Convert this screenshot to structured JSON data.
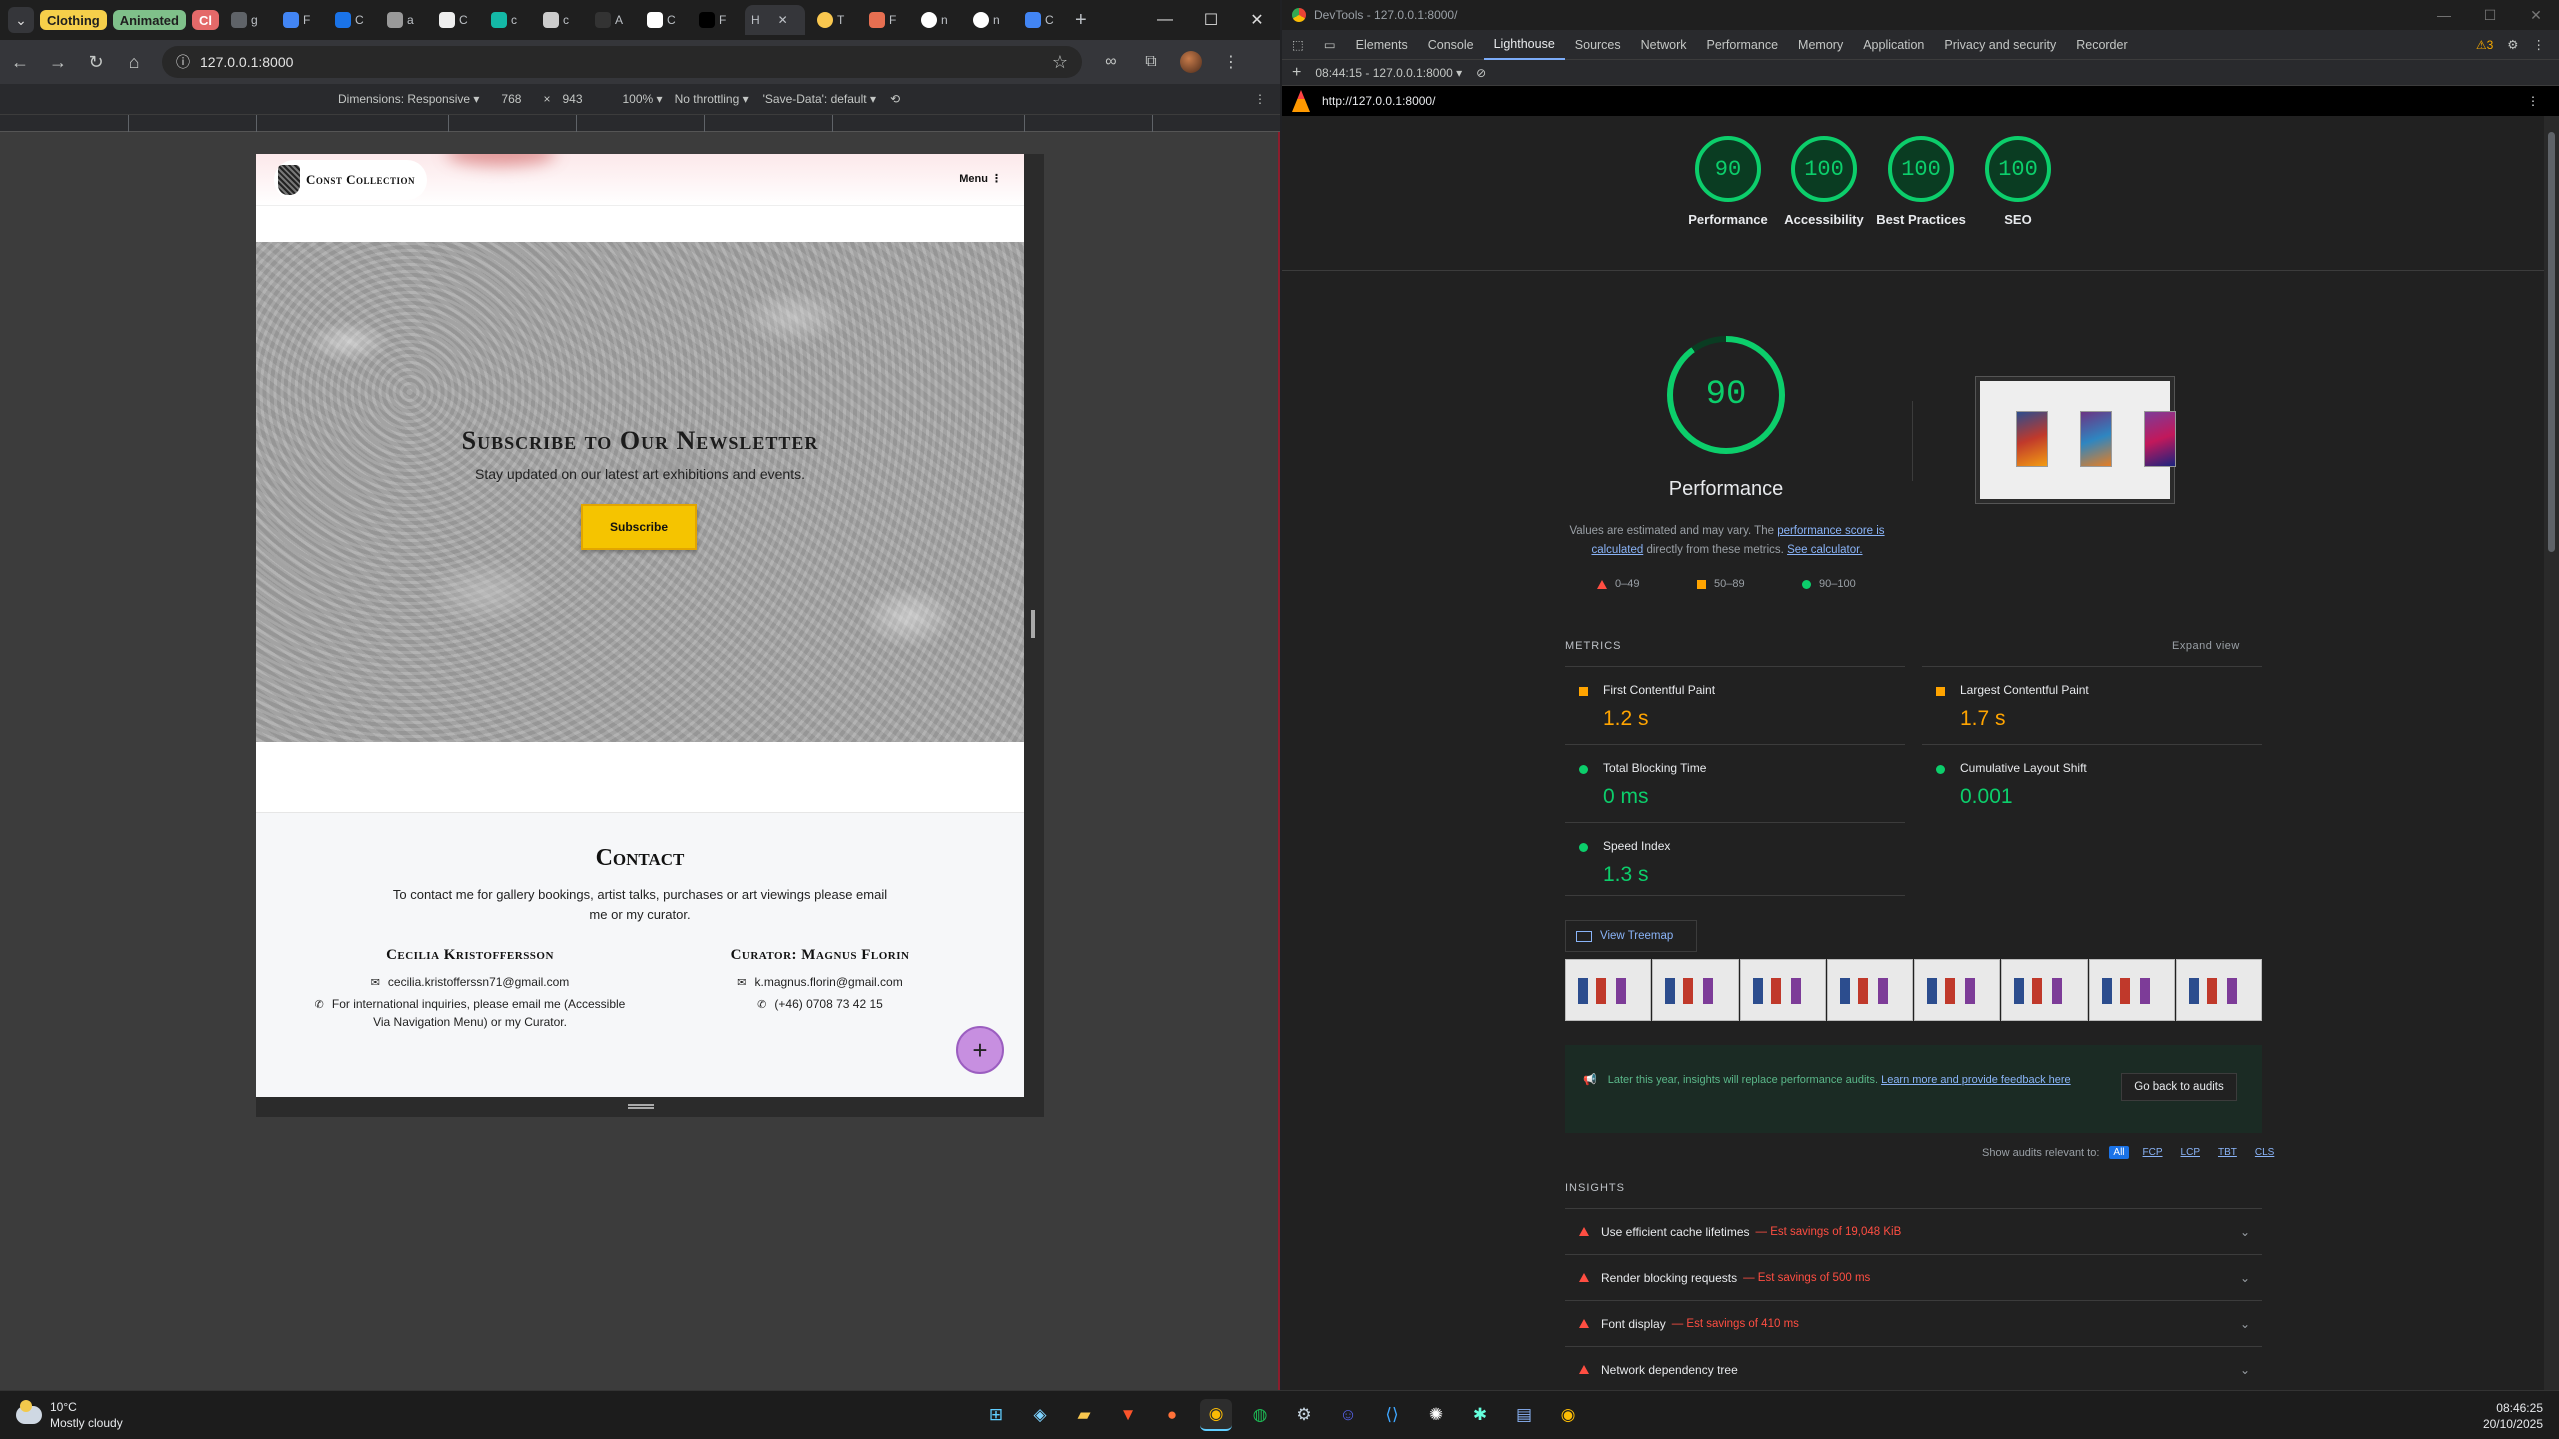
{
  "browser": {
    "tab_groups": [
      {
        "label": "Clothing",
        "color": "#f6cf4a"
      },
      {
        "label": "Animated",
        "color": "#7fc08a"
      },
      {
        "label": "Cl",
        "color": "#e46969"
      }
    ],
    "tabs": [
      {
        "label": "g"
      },
      {
        "label": "F"
      },
      {
        "label": "C"
      },
      {
        "label": "a"
      },
      {
        "label": "C"
      },
      {
        "label": "c"
      },
      {
        "label": "c"
      },
      {
        "label": "A"
      },
      {
        "label": "C"
      },
      {
        "label": "F"
      },
      {
        "label": "H"
      },
      {
        "label": "T"
      },
      {
        "label": "F"
      },
      {
        "label": "n"
      },
      {
        "label": "n"
      },
      {
        "label": "C"
      }
    ],
    "url": "127.0.0.1:8000",
    "device_toolbar": {
      "dimensions": "Dimensions: Responsive",
      "width": "768",
      "x": "×",
      "height": "943",
      "zoom": "100%",
      "throttling": "No throttling",
      "save_data": "'Save-Data': default"
    }
  },
  "site": {
    "logo_text": "Const Collection",
    "menu_label": "Menu",
    "newsletter": {
      "title": "Subscribe to Our Newsletter",
      "subtitle": "Stay updated on our latest art exhibitions and events.",
      "button": "Subscribe"
    },
    "contact": {
      "title": "Contact",
      "description": "To contact me for gallery bookings, artist talks, purchases or art viewings please email me or my curator.",
      "left": {
        "name": "Cecilia Kristoffersson",
        "email": "cecilia.kristofferssn71@gmail.com",
        "note": "For international inquiries, please email me (Accessible Via Navigation Menu) or my Curator."
      },
      "right": {
        "name": "Curator: Magnus Florin",
        "email": "k.magnus.florin@gmail.com",
        "phone": "(+46) 0708 73 42 15"
      }
    }
  },
  "devtools": {
    "title": "DevTools - 127.0.0.1:8000/",
    "tabs": [
      "Elements",
      "Console",
      "Lighthouse",
      "Sources",
      "Network",
      "Performance",
      "Memory",
      "Application",
      "Privacy and security",
      "Recorder"
    ],
    "active_tab": "Lighthouse",
    "warnings": "3",
    "report_select": "08:44:15 - 127.0.0.1:8000",
    "report_url": "http://127.0.0.1:8000/",
    "scores": [
      {
        "value": "90",
        "label": "Performance"
      },
      {
        "value": "100",
        "label": "Accessibility"
      },
      {
        "value": "100",
        "label": "Best Practices"
      },
      {
        "value": "100",
        "label": "SEO"
      }
    ],
    "main_score": {
      "value": "90",
      "label": "Performance",
      "fraction": 0.9
    },
    "note_text": "Values are estimated and may vary. The",
    "note_link1": "performance score is calculated",
    "note_mid": "directly from these metrics.",
    "note_link2": "See calculator.",
    "legend": [
      "0–49",
      "50–89",
      "90–100"
    ],
    "metrics_heading": "METRICS",
    "expand_view": "Expand view",
    "metrics": [
      {
        "name": "First Contentful Paint",
        "value": "1.2 s",
        "status": "average"
      },
      {
        "name": "Largest Contentful Paint",
        "value": "1.7 s",
        "status": "average"
      },
      {
        "name": "Total Blocking Time",
        "value": "0 ms",
        "status": "pass"
      },
      {
        "name": "Cumulative Layout Shift",
        "value": "0.001",
        "status": "pass"
      },
      {
        "name": "Speed Index",
        "value": "1.3 s",
        "status": "pass"
      }
    ],
    "treemap": "View Treemap",
    "insight_banner": {
      "text": "Later this year, insights will replace performance audits.",
      "link": "Learn more and provide feedback here",
      "button": "Go back to audits"
    },
    "show_audits_label": "Show audits relevant to:",
    "filters": [
      "All",
      "FCP",
      "LCP",
      "TBT",
      "CLS"
    ],
    "insights_heading": "INSIGHTS",
    "insights": [
      {
        "name": "Use efficient cache lifetimes",
        "savings": "— Est savings of 19,048 KiB"
      },
      {
        "name": "Render blocking requests",
        "savings": "— Est savings of 500 ms"
      },
      {
        "name": "Font display",
        "savings": "— Est savings of 410 ms"
      },
      {
        "name": "Network dependency tree",
        "savings": ""
      }
    ]
  },
  "taskbar": {
    "temp": "10°C",
    "weather": "Mostly cloudy",
    "time": "08:46:25",
    "date": "20/10/2025"
  },
  "colors": {
    "pass": "#0cce6b",
    "average": "#ffa400",
    "fail": "#ff4e42",
    "link": "#8ab4f8",
    "subscribe": "#f5c400",
    "fab": "#c78fe0"
  }
}
